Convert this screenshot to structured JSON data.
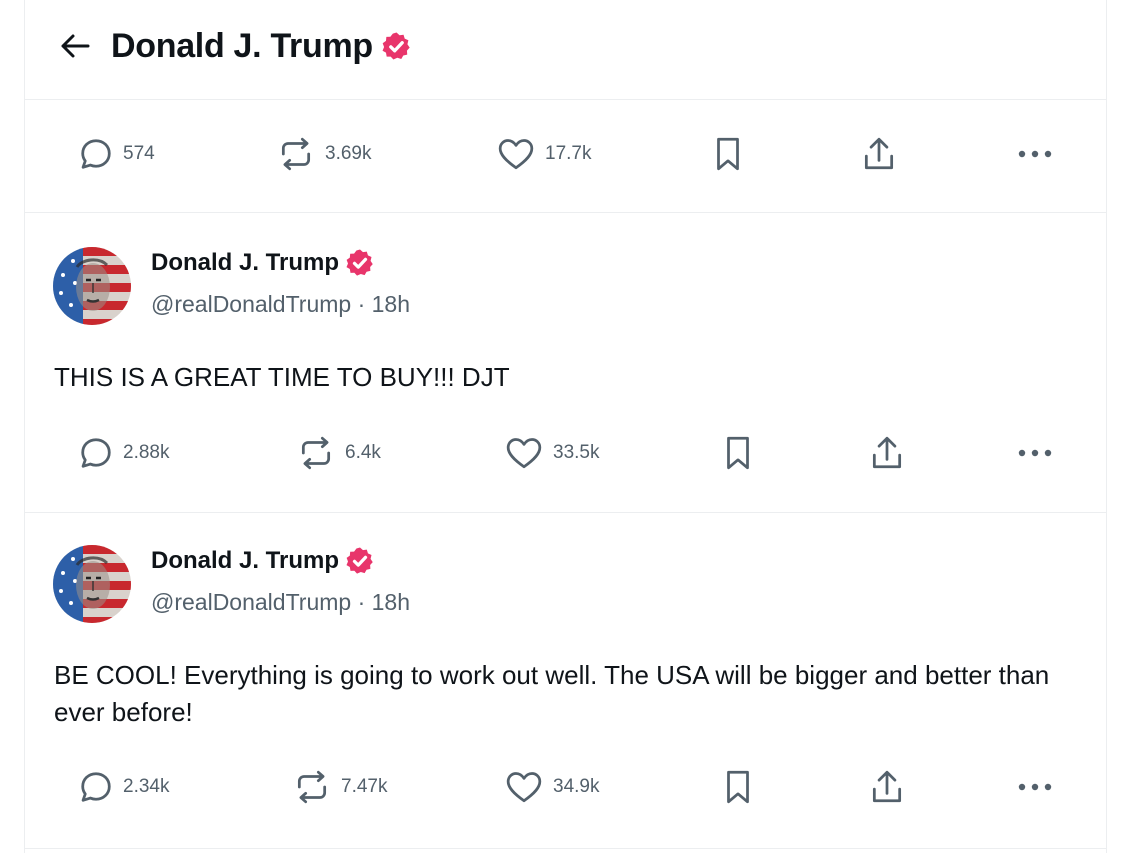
{
  "header": {
    "title": "Donald J. Trump"
  },
  "top_actions": {
    "replies": "574",
    "reposts": "3.69k",
    "likes": "17.7k"
  },
  "posts": [
    {
      "author_name": "Donald J. Trump",
      "handle": "@realDonaldTrump",
      "separator": "·",
      "time": "18h",
      "text": "THIS IS A GREAT TIME TO BUY!!! DJT",
      "replies": "2.88k",
      "reposts": "6.4k",
      "likes": "33.5k"
    },
    {
      "author_name": "Donald J. Trump",
      "handle": "@realDonaldTrump",
      "separator": "·",
      "time": "18h",
      "text": "BE COOL! Everything is going to work out well. The USA will be bigger and better than ever before!",
      "replies": "2.34k",
      "reposts": "7.47k",
      "likes": "34.9k"
    }
  ],
  "icons": {
    "back": "arrow-left-icon",
    "verified": "verified-badge-icon",
    "reply": "speech-bubble-icon",
    "repost": "repost-arrows-icon",
    "like": "heart-icon",
    "bookmark": "bookmark-icon",
    "share": "share-upload-icon",
    "more": "more-dots-icon"
  },
  "colors": {
    "verified_badge": "#e8356b",
    "text_primary": "#0f1419",
    "text_secondary": "#53606b",
    "divider": "#eceef0"
  }
}
